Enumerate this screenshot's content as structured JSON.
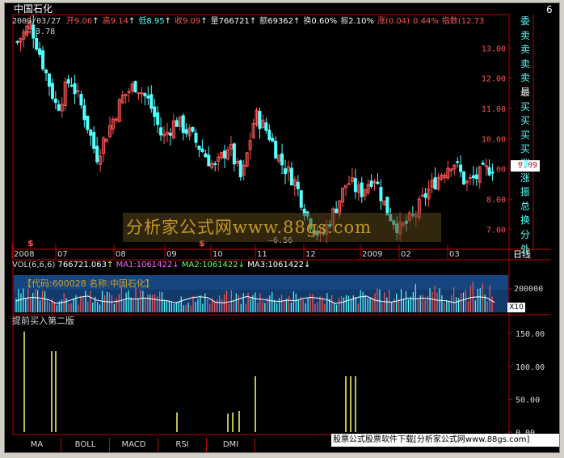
{
  "stock": {
    "name": "中国石化",
    "date": "2009/03/27",
    "info_items": [
      {
        "label": "开",
        "value": "9.06",
        "arrow": "↑",
        "color": "#ff5555"
      },
      {
        "label": "高",
        "value": "9.14",
        "arrow": "↑",
        "color": "#ff5555"
      },
      {
        "label": "低",
        "value": "8.95",
        "arrow": "↑",
        "color": "#54ffff"
      },
      {
        "label": "收",
        "value": "9.09",
        "arrow": "↑",
        "color": "#ff5555"
      },
      {
        "label": "量",
        "value": "766721",
        "arrow": "↑",
        "color": "#d8d8d8"
      },
      {
        "label": "额",
        "value": "69362",
        "arrow": "↑",
        "color": "#d8d8d8"
      },
      {
        "label": "换",
        "value": "0.60%",
        "arrow": "",
        "color": "#d8d8d8"
      },
      {
        "label": "振",
        "value": "2.10%",
        "arrow": "",
        "color": "#d8d8d8"
      },
      {
        "label": "涨",
        "value": "(0.04)",
        "arrow": "",
        "color": "#ff5555"
      },
      {
        "label": "",
        "value": "0.44%",
        "arrow": "",
        "color": "#ff5555"
      },
      {
        "label": "指数",
        "value": "(12.73",
        "arrow": "",
        "color": "#ff5555"
      }
    ],
    "corner_digit": "6",
    "max_label": "13.78",
    "min_label": "6.56",
    "current_price": "9.09",
    "period": "日线"
  },
  "price_axis": [
    "13.00",
    "12.00",
    "11.00",
    "10.00",
    "9.00",
    "8.00",
    "7.00"
  ],
  "date_axis": [
    "2008",
    "07",
    "08",
    "09",
    "10",
    "11",
    "12",
    "2009",
    "02",
    "03"
  ],
  "flags": [
    "$",
    "$"
  ],
  "right_tabs": [
    "委",
    "卖",
    "卖",
    "卖",
    "卖",
    "最",
    "买",
    "买",
    "买",
    "买",
    "涨",
    "涨",
    "振",
    "总",
    "换",
    "分",
    "外"
  ],
  "volume": {
    "title": "VOL(6,6,6)",
    "value": "766721.063",
    "ma1": "MA1:1061422",
    "ma2": "MA2:1061422",
    "ma3": "MA3:1061422",
    "info_box": "【代码:600028 名称:中国石化】",
    "axis_label": "200000",
    "multiplier": "X10"
  },
  "indicator": {
    "title": "提前买入第二版",
    "axis": [
      "150.00",
      "100.00",
      "50.00",
      "0.00"
    ]
  },
  "bottom_tabs": [
    "MA",
    "BOLL",
    "MACD",
    "RSI",
    "DMI"
  ],
  "status_text": "股票公式股票软件下载[分析家公式网www.88gs.com]",
  "watermark": {
    "cjk": "分析家公式网",
    "latin": "www.88gs.com"
  },
  "colors": {
    "up": "#ff5555",
    "down": "#54ffff",
    "grid": "#c00000",
    "signal": "#ffff66"
  },
  "chart_data": [
    {
      "type": "candlestick",
      "title": "中国石化 日线",
      "x": [
        "2008-01",
        "2008-02",
        "2008-03",
        "2008-04",
        "2008-05",
        "2008-06",
        "2008-07",
        "2008-08",
        "2008-09",
        "2008-10",
        "2008-11",
        "2008-12",
        "2009-01",
        "2009-02",
        "2009-03"
      ],
      "close": [
        13.0,
        11.2,
        10.2,
        11.3,
        11.7,
        9.6,
        10.3,
        11.4,
        10.0,
        9.3,
        7.5,
        8.6,
        7.2,
        8.9,
        9.09
      ],
      "ylim": [
        6.5,
        14.0
      ],
      "annotations": [
        "13.78",
        "6.56",
        "9.09"
      ]
    },
    {
      "type": "bar",
      "title": "VOL(6,6,6)",
      "series": [
        {
          "name": "VOL",
          "values": [
            110000,
            90000,
            100000,
            120000,
            95000,
            85000,
            105000,
            115000,
            100000,
            90000,
            110000,
            130000,
            120000,
            140000,
            130000
          ]
        }
      ],
      "ylim": [
        0,
        250000
      ]
    },
    {
      "type": "bar",
      "title": "提前买入第二版",
      "x": [
        "2008-01",
        "2008-01b",
        "2008-02",
        "2008-09",
        "2008-10",
        "2008-10b",
        "2008-11",
        "2009-02"
      ],
      "values": [
        153,
        123,
        123,
        30,
        28,
        30,
        85,
        85
      ],
      "ylim": [
        0,
        160
      ]
    }
  ]
}
